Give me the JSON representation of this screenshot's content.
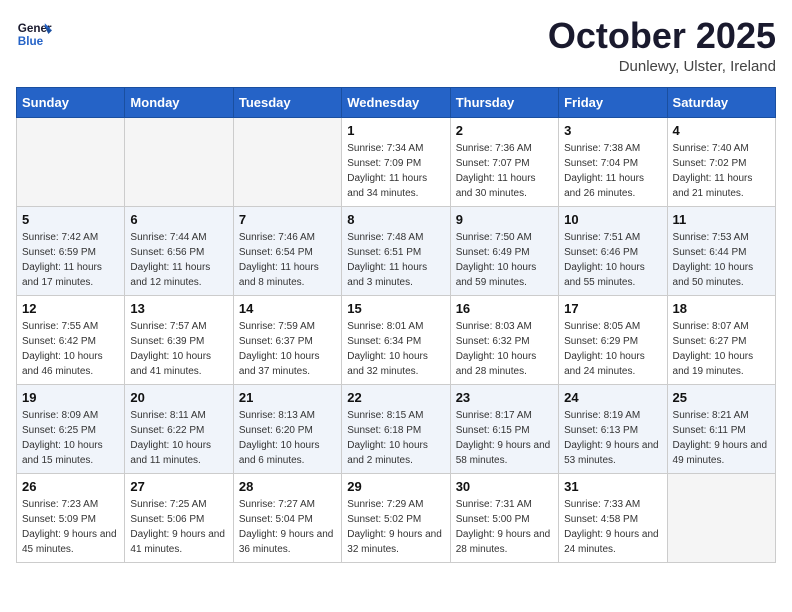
{
  "logo": {
    "line1": "General",
    "line2": "Blue"
  },
  "title": "October 2025",
  "location": "Dunlewy, Ulster, Ireland",
  "weekdays": [
    "Sunday",
    "Monday",
    "Tuesday",
    "Wednesday",
    "Thursday",
    "Friday",
    "Saturday"
  ],
  "weeks": [
    [
      {
        "day": "",
        "sunrise": "",
        "sunset": "",
        "daylight": ""
      },
      {
        "day": "",
        "sunrise": "",
        "sunset": "",
        "daylight": ""
      },
      {
        "day": "",
        "sunrise": "",
        "sunset": "",
        "daylight": ""
      },
      {
        "day": "1",
        "sunrise": "Sunrise: 7:34 AM",
        "sunset": "Sunset: 7:09 PM",
        "daylight": "Daylight: 11 hours and 34 minutes."
      },
      {
        "day": "2",
        "sunrise": "Sunrise: 7:36 AM",
        "sunset": "Sunset: 7:07 PM",
        "daylight": "Daylight: 11 hours and 30 minutes."
      },
      {
        "day": "3",
        "sunrise": "Sunrise: 7:38 AM",
        "sunset": "Sunset: 7:04 PM",
        "daylight": "Daylight: 11 hours and 26 minutes."
      },
      {
        "day": "4",
        "sunrise": "Sunrise: 7:40 AM",
        "sunset": "Sunset: 7:02 PM",
        "daylight": "Daylight: 11 hours and 21 minutes."
      }
    ],
    [
      {
        "day": "5",
        "sunrise": "Sunrise: 7:42 AM",
        "sunset": "Sunset: 6:59 PM",
        "daylight": "Daylight: 11 hours and 17 minutes."
      },
      {
        "day": "6",
        "sunrise": "Sunrise: 7:44 AM",
        "sunset": "Sunset: 6:56 PM",
        "daylight": "Daylight: 11 hours and 12 minutes."
      },
      {
        "day": "7",
        "sunrise": "Sunrise: 7:46 AM",
        "sunset": "Sunset: 6:54 PM",
        "daylight": "Daylight: 11 hours and 8 minutes."
      },
      {
        "day": "8",
        "sunrise": "Sunrise: 7:48 AM",
        "sunset": "Sunset: 6:51 PM",
        "daylight": "Daylight: 11 hours and 3 minutes."
      },
      {
        "day": "9",
        "sunrise": "Sunrise: 7:50 AM",
        "sunset": "Sunset: 6:49 PM",
        "daylight": "Daylight: 10 hours and 59 minutes."
      },
      {
        "day": "10",
        "sunrise": "Sunrise: 7:51 AM",
        "sunset": "Sunset: 6:46 PM",
        "daylight": "Daylight: 10 hours and 55 minutes."
      },
      {
        "day": "11",
        "sunrise": "Sunrise: 7:53 AM",
        "sunset": "Sunset: 6:44 PM",
        "daylight": "Daylight: 10 hours and 50 minutes."
      }
    ],
    [
      {
        "day": "12",
        "sunrise": "Sunrise: 7:55 AM",
        "sunset": "Sunset: 6:42 PM",
        "daylight": "Daylight: 10 hours and 46 minutes."
      },
      {
        "day": "13",
        "sunrise": "Sunrise: 7:57 AM",
        "sunset": "Sunset: 6:39 PM",
        "daylight": "Daylight: 10 hours and 41 minutes."
      },
      {
        "day": "14",
        "sunrise": "Sunrise: 7:59 AM",
        "sunset": "Sunset: 6:37 PM",
        "daylight": "Daylight: 10 hours and 37 minutes."
      },
      {
        "day": "15",
        "sunrise": "Sunrise: 8:01 AM",
        "sunset": "Sunset: 6:34 PM",
        "daylight": "Daylight: 10 hours and 32 minutes."
      },
      {
        "day": "16",
        "sunrise": "Sunrise: 8:03 AM",
        "sunset": "Sunset: 6:32 PM",
        "daylight": "Daylight: 10 hours and 28 minutes."
      },
      {
        "day": "17",
        "sunrise": "Sunrise: 8:05 AM",
        "sunset": "Sunset: 6:29 PM",
        "daylight": "Daylight: 10 hours and 24 minutes."
      },
      {
        "day": "18",
        "sunrise": "Sunrise: 8:07 AM",
        "sunset": "Sunset: 6:27 PM",
        "daylight": "Daylight: 10 hours and 19 minutes."
      }
    ],
    [
      {
        "day": "19",
        "sunrise": "Sunrise: 8:09 AM",
        "sunset": "Sunset: 6:25 PM",
        "daylight": "Daylight: 10 hours and 15 minutes."
      },
      {
        "day": "20",
        "sunrise": "Sunrise: 8:11 AM",
        "sunset": "Sunset: 6:22 PM",
        "daylight": "Daylight: 10 hours and 11 minutes."
      },
      {
        "day": "21",
        "sunrise": "Sunrise: 8:13 AM",
        "sunset": "Sunset: 6:20 PM",
        "daylight": "Daylight: 10 hours and 6 minutes."
      },
      {
        "day": "22",
        "sunrise": "Sunrise: 8:15 AM",
        "sunset": "Sunset: 6:18 PM",
        "daylight": "Daylight: 10 hours and 2 minutes."
      },
      {
        "day": "23",
        "sunrise": "Sunrise: 8:17 AM",
        "sunset": "Sunset: 6:15 PM",
        "daylight": "Daylight: 9 hours and 58 minutes."
      },
      {
        "day": "24",
        "sunrise": "Sunrise: 8:19 AM",
        "sunset": "Sunset: 6:13 PM",
        "daylight": "Daylight: 9 hours and 53 minutes."
      },
      {
        "day": "25",
        "sunrise": "Sunrise: 8:21 AM",
        "sunset": "Sunset: 6:11 PM",
        "daylight": "Daylight: 9 hours and 49 minutes."
      }
    ],
    [
      {
        "day": "26",
        "sunrise": "Sunrise: 7:23 AM",
        "sunset": "Sunset: 5:09 PM",
        "daylight": "Daylight: 9 hours and 45 minutes."
      },
      {
        "day": "27",
        "sunrise": "Sunrise: 7:25 AM",
        "sunset": "Sunset: 5:06 PM",
        "daylight": "Daylight: 9 hours and 41 minutes."
      },
      {
        "day": "28",
        "sunrise": "Sunrise: 7:27 AM",
        "sunset": "Sunset: 5:04 PM",
        "daylight": "Daylight: 9 hours and 36 minutes."
      },
      {
        "day": "29",
        "sunrise": "Sunrise: 7:29 AM",
        "sunset": "Sunset: 5:02 PM",
        "daylight": "Daylight: 9 hours and 32 minutes."
      },
      {
        "day": "30",
        "sunrise": "Sunrise: 7:31 AM",
        "sunset": "Sunset: 5:00 PM",
        "daylight": "Daylight: 9 hours and 28 minutes."
      },
      {
        "day": "31",
        "sunrise": "Sunrise: 7:33 AM",
        "sunset": "Sunset: 4:58 PM",
        "daylight": "Daylight: 9 hours and 24 minutes."
      },
      {
        "day": "",
        "sunrise": "",
        "sunset": "",
        "daylight": ""
      }
    ]
  ]
}
